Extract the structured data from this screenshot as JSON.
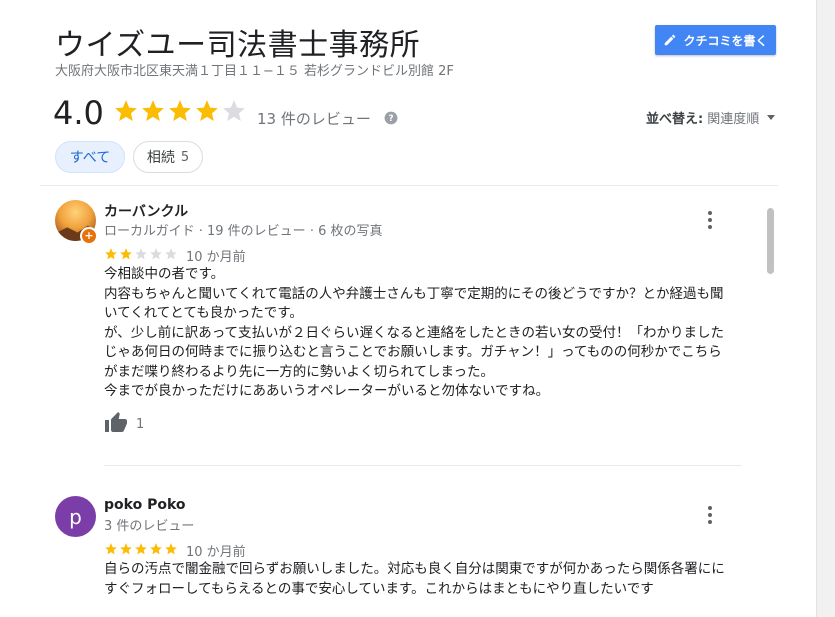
{
  "business": {
    "name": "ウイズユー司法書士事務所",
    "address": "大阪府大阪市北区東天満１丁目１１−１５ 若杉グランドビル別館 2F"
  },
  "write_review_button": {
    "label": "クチコミを書く",
    "icon": "pencil-icon"
  },
  "summary": {
    "rating": "4.0",
    "rating_value": 4.0,
    "review_count_label": "13 件のレビュー",
    "help_icon": "question-circle-icon"
  },
  "sort": {
    "label": "並べ替え:",
    "value": "関連度順"
  },
  "filters": {
    "all": "すべて",
    "consult": {
      "label": "相続",
      "count": "5"
    }
  },
  "reviews": [
    {
      "author": "カーバンクル",
      "meta": "ローカルガイド · 19 件のレビュー · 6 枚の写真",
      "rating": 2,
      "time": "10 か月前",
      "lines": [
        "今相談中の者です。",
        "内容もちゃんと聞いてくれて電話の人や弁護士さんも丁寧で定期的にその後どうですか？とか経過も聞",
        "いてくれてとても良かったです。",
        "が、少し前に訳あって支払いが２日ぐらい遅くなると連絡をしたときの若い女の受付！「わかりました",
        "じゃあ何日の何時までに振り込むと言うことでお願いします。ガチャン！」ってものの何秒かでこちら",
        "がまだ喋り終わるより先に一方的に勢いよく切られてしまった。",
        "今までが良かっただけにああいうオペレーターがいると勿体ないですね。"
      ],
      "likes": "1"
    },
    {
      "author": "poko Poko",
      "avatar_letter": "p",
      "meta": "3 件のレビュー",
      "rating": 5,
      "time": "10 か月前",
      "lines": [
        "自らの汚点で闇金融で回らずお願いしました。対応も良く自分は関東ですが何かあったら関係各署にに",
        "すぐフォローしてもらえるとの事で安心しています。これからはまともにやり直したいです"
      ]
    }
  ],
  "colors": {
    "star": "#fbbc04",
    "star_empty": "#dadce0",
    "accent": "#4285f4",
    "chip_active_bg": "#e8f0fe",
    "chip_active_text": "#1967d2"
  }
}
